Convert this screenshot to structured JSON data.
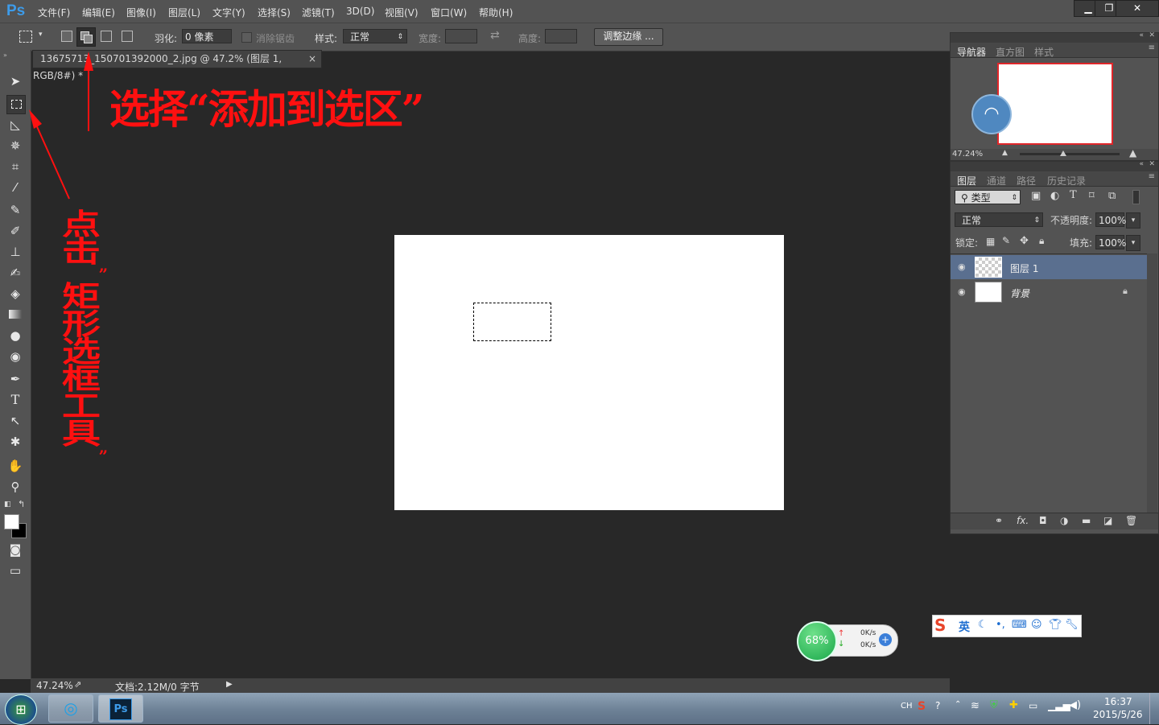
{
  "app": {
    "logo": "Ps"
  },
  "menu": [
    "文件(F)",
    "编辑(E)",
    "图像(I)",
    "图层(L)",
    "文字(Y)",
    "选择(S)",
    "滤镜(T)",
    "3D(D)",
    "视图(V)",
    "窗口(W)",
    "帮助(H)"
  ],
  "window_buttons": {
    "minimize": "▁",
    "restore": "❐",
    "close": "✕"
  },
  "options": {
    "feather_label": "羽化:",
    "feather_value": "0 像素",
    "antialias_label": "消除锯齿",
    "style_label": "样式:",
    "style_value": "正常",
    "width_label": "宽度:",
    "height_label": "高度:",
    "refine_button": "调整边缘 ..."
  },
  "document": {
    "tab_title": "13675713_150701392000_2.jpg @ 47.2% (图层 1, RGB/8#) *",
    "tab_close": "×",
    "zoom": "47.24%",
    "doc_info": "文档:2.12M/0 字节"
  },
  "navigator": {
    "tabs": [
      "导航器",
      "直方图",
      "样式"
    ],
    "zoom": "47.24%"
  },
  "layers_panel": {
    "tabs": [
      "图层",
      "通道",
      "路径",
      "历史记录"
    ],
    "filter_label": "类型",
    "blend_mode": "正常",
    "opacity_label": "不透明度:",
    "opacity_value": "100%",
    "lock_label": "锁定:",
    "fill_label": "填充:",
    "fill_value": "100%",
    "layers": [
      {
        "name": "图层 1"
      },
      {
        "name": "背景"
      }
    ],
    "footer_icons": [
      "link-icon",
      "fx-icon",
      "mask-icon",
      "adjustment-icon",
      "folder-icon",
      "new-layer-icon",
      "trash-icon"
    ]
  },
  "annotations": {
    "top": "选择“添加到选区”",
    "side": [
      "点",
      "击",
      "”",
      "矩",
      "形",
      "选",
      "框",
      "工",
      "具",
      "”"
    ]
  },
  "widgets": {
    "network_percent": "68%",
    "upload": "0K/s",
    "download": "0K/s",
    "ime_label": "英"
  },
  "taskbar": {
    "tray_lang": "CH",
    "time": "16:37",
    "date": "2015/5/26"
  },
  "colors": {
    "accent": "#3d9be9",
    "annotation": "#ff1010",
    "selected_layer": "#5a6f8f"
  }
}
